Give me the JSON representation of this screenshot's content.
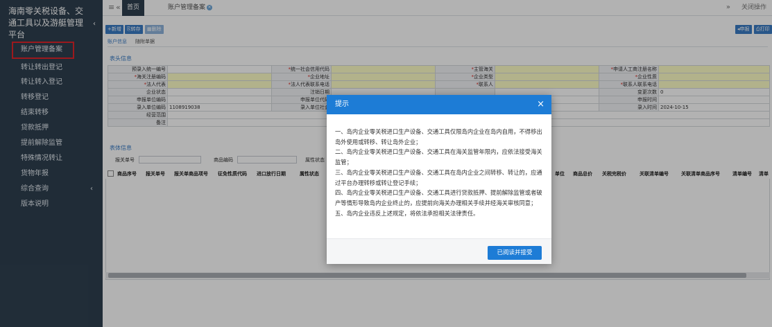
{
  "sidebar": {
    "title": "海南零关税设备、交通工具以及游艇管理平台",
    "collapse_glyph": "‹",
    "items": [
      {
        "label": "账户管理备案",
        "active": true
      },
      {
        "label": "转让转出登记"
      },
      {
        "label": "转让转入登记"
      },
      {
        "label": "转移登记"
      },
      {
        "label": "结束转移"
      },
      {
        "label": "贷款抵押"
      },
      {
        "label": "提前解除监管"
      },
      {
        "label": "特殊情况转让"
      },
      {
        "label": "货物年报"
      },
      {
        "label": "综合查询",
        "has_submenu": true
      },
      {
        "label": "版本说明"
      }
    ],
    "highlight_color": "#e0242a"
  },
  "topbar": {
    "menu_icon": "≡",
    "back_icon": "«",
    "home_tab": "首页",
    "current_tab": "账户管理备案",
    "forward_icon": "»",
    "close_ops": "关闭操作"
  },
  "toolbar": {
    "add": "+新增",
    "save": "转存",
    "delete": "删除",
    "declare": "申报",
    "print": "打印"
  },
  "subtabs": [
    "账户信息",
    "随附单据"
  ],
  "header_section": {
    "title": "表头信息",
    "rows": [
      [
        {
          "label": "预录入统一编号",
          "req": false,
          "value": ""
        },
        {
          "label": "统一社会信用代码",
          "req": true,
          "value": ""
        },
        {
          "label": "主管海关",
          "req": true,
          "value": ""
        },
        {
          "label": "申请人工商注册名称",
          "req": true,
          "value": ""
        }
      ],
      [
        {
          "label": "海关注册编码",
          "req": true,
          "value": ""
        },
        {
          "label": "企业地址",
          "req": true,
          "value": ""
        },
        {
          "label": "企业类型",
          "req": true,
          "value": ""
        },
        {
          "label": "企业性质",
          "req": true,
          "value": ""
        }
      ],
      [
        {
          "label": "法人代表",
          "req": true,
          "value": ""
        },
        {
          "label": "法人代表联系电话",
          "req": true,
          "value": ""
        },
        {
          "label": "联系人",
          "req": true,
          "value": ""
        },
        {
          "label": "联系人联系电话",
          "req": true,
          "value": ""
        }
      ],
      [
        {
          "label": "企业状态",
          "req": false,
          "value": ""
        },
        {
          "label": "注销日期",
          "req": false,
          "value": ""
        },
        {
          "label": "",
          "req": false,
          "value": ""
        },
        {
          "label": "变更次数",
          "req": false,
          "value": "0"
        }
      ],
      [
        {
          "label": "申报单位编码",
          "req": false,
          "value": ""
        },
        {
          "label": "申报单位代码",
          "req": false,
          "value": ""
        },
        {
          "label": "",
          "req": false,
          "value": ""
        },
        {
          "label": "申报时间",
          "req": false,
          "value": ""
        }
      ],
      [
        {
          "label": "录入单位编码",
          "req": false,
          "value": "1108919038"
        },
        {
          "label": "录入单位社会",
          "req": false,
          "value": ""
        },
        {
          "label": "",
          "req": false,
          "value": ""
        },
        {
          "label": "录入时间",
          "req": false,
          "value": "2024-10-15"
        }
      ],
      [
        {
          "label": "经营范围",
          "req": false,
          "value": ""
        }
      ],
      [
        {
          "label": "备注",
          "req": false,
          "value": ""
        }
      ]
    ]
  },
  "detail_section": {
    "title": "表体信息",
    "filters": [
      "报关单号",
      "商品编码",
      "属性状态"
    ],
    "columns_left": [
      "商品序号",
      "报关单号",
      "报关单商品项号",
      "征免性质代码",
      "进口放行日期",
      "属性状态"
    ],
    "columns_right": [
      "单位",
      "商品总价",
      "关税完税价",
      "关联清单编号",
      "关联清单商品序号",
      "清单编号",
      "清单"
    ]
  },
  "modal": {
    "title": "提示",
    "close": "×",
    "paragraphs": [
      "一、岛内企业零关税进口生产设备、交通工具仅限岛内企业在岛内自用，不得移出岛外使用或转移、转让岛外企业；",
      "二、岛内企业零关税进口生产设备、交通工具在海关监管年限内，应依法接受海关监管；",
      "三、岛内企业零关税进口生产设备、交通工具在岛内企业之间转移、转让的，应通过平台办理转移或转让登记手续；",
      "四、岛内企业零关税进口生产设备、交通工具进行贷款抵押、提前解除监管或者破产等情形导致岛内企业终止的，应提前向海关办理相关手续并经海关审核同意；",
      "五、岛内企业违反上述规定，将依法承担相关法律责任。"
    ],
    "accept_button": "已阅读并接受"
  },
  "colors": {
    "sidebar_bg": "#2f4050",
    "accent_blue": "#1d7cd6",
    "required_bg": "#ffffc8"
  }
}
